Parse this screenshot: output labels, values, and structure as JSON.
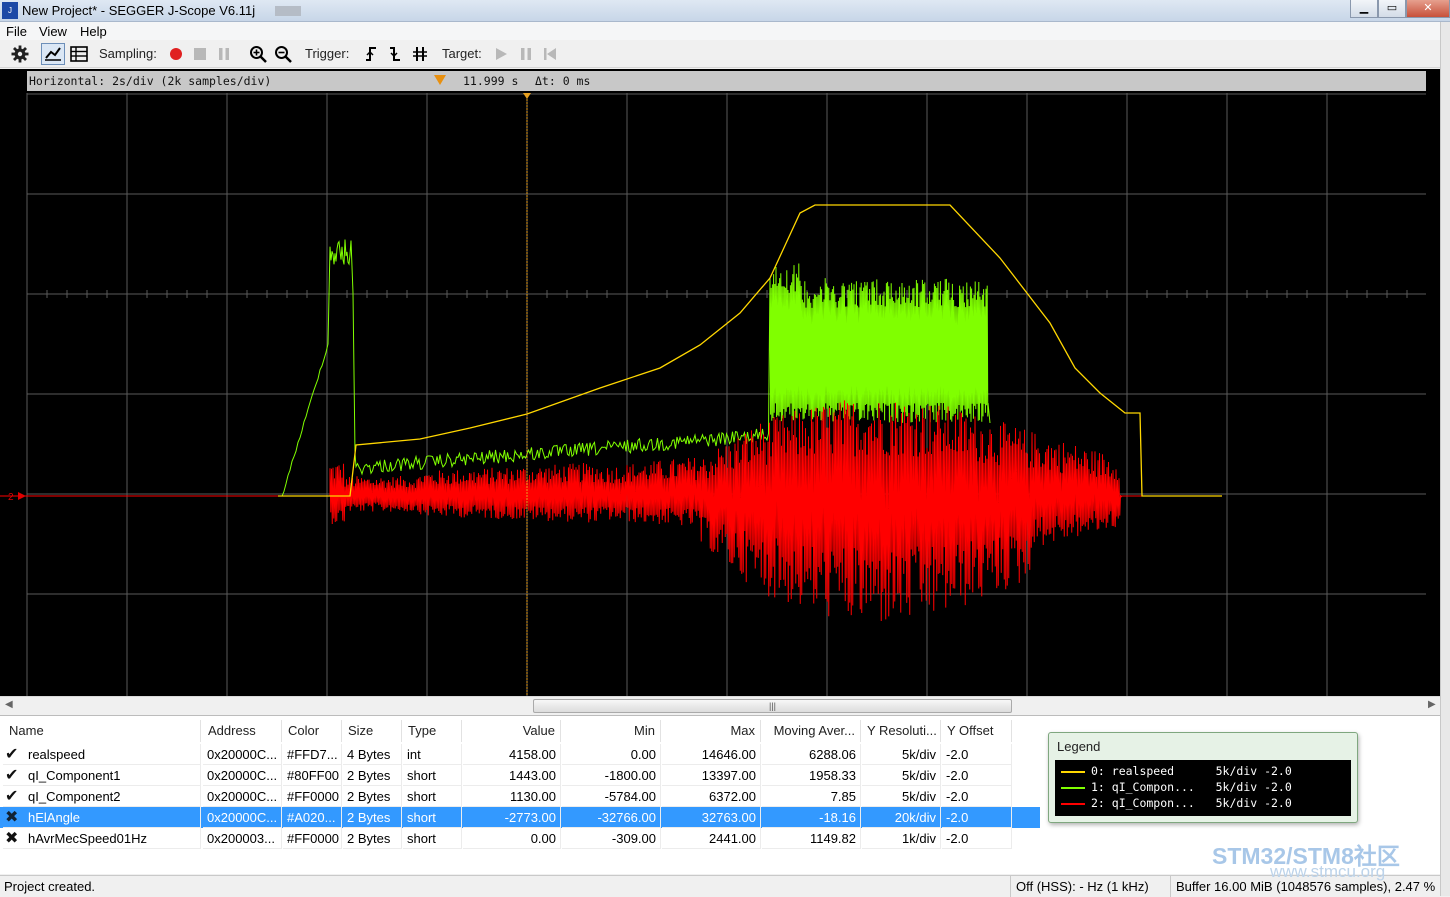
{
  "window": {
    "title": "New Project* - SEGGER J-Scope V6.11j",
    "app_icon_text": "J-Scope",
    "controls": {
      "minimize": "▁",
      "maximize": "▭",
      "close": "✕"
    }
  },
  "menu": {
    "items": [
      {
        "label": "File",
        "mnemonic": "F"
      },
      {
        "label": "View",
        "mnemonic": "V"
      },
      {
        "label": "Help",
        "mnemonic": "H"
      }
    ]
  },
  "toolbar": {
    "sampling_label": "Sampling:",
    "trigger_label": "Trigger:",
    "target_label": "Target:",
    "icons": [
      "gear-icon",
      "line-chart-icon",
      "table-icon",
      "record-icon",
      "stop-icon",
      "pause-icon",
      "zoom-in-icon",
      "zoom-out-icon",
      "trigger-rising-icon",
      "trigger-falling-icon",
      "trigger-both-icon",
      "play-icon",
      "target-pause-icon",
      "target-step-icon"
    ],
    "colors": {
      "record": "#e02020",
      "disabled": "#b8b8b8"
    }
  },
  "scope": {
    "horizontal": "Horizontal: 2s/div (2k samples/div)",
    "cursor_time": "11.999 s",
    "delta_t": "Δt: 0 ms",
    "offset_marker": "2",
    "background": "#000000",
    "grid_color": "#5a5a5a",
    "cursor_color": "#e8a020"
  },
  "table": {
    "columns": [
      "Name",
      "Address",
      "Color",
      "Size",
      "Type",
      "Value",
      "Min",
      "Max",
      "Moving Aver...",
      "Y Resoluti...",
      "Y Offset"
    ],
    "rows": [
      {
        "enabled": "✔",
        "name": "realspeed",
        "address": "0x20000C...",
        "color": "#FFD7...",
        "size": "4 Bytes",
        "type": "int",
        "value": "4158.00",
        "min": "0.00",
        "max": "14646.00",
        "avg": "6288.06",
        "yres": "5k/div",
        "yoff": "-2.0"
      },
      {
        "enabled": "✔",
        "name": "qI_Component1",
        "address": "0x20000C...",
        "color": "#80FF00",
        "size": "2 Bytes",
        "type": "short",
        "value": "1443.00",
        "min": "-1800.00",
        "max": "13397.00",
        "avg": "1958.33",
        "yres": "5k/div",
        "yoff": "-2.0"
      },
      {
        "enabled": "✔",
        "name": "qI_Component2",
        "address": "0x20000C...",
        "color": "#FF0000",
        "size": "2 Bytes",
        "type": "short",
        "value": "1130.00",
        "min": "-5784.00",
        "max": "6372.00",
        "avg": "7.85",
        "yres": "5k/div",
        "yoff": "-2.0"
      },
      {
        "enabled": "✖",
        "name": "hElAngle",
        "address": "0x20000C...",
        "color": "#A020...",
        "size": "2 Bytes",
        "type": "short",
        "value": "-2773.00",
        "min": "-32766.00",
        "max": "32763.00",
        "avg": "-18.16",
        "yres": "20k/div",
        "yoff": "-2.0"
      },
      {
        "enabled": "✖",
        "name": "hAvrMecSpeed01Hz",
        "address": "0x200003...",
        "color": "#FF0000",
        "size": "2 Bytes",
        "type": "short",
        "value": "0.00",
        "min": "-309.00",
        "max": "2441.00",
        "avg": "1149.82",
        "yres": "1k/div",
        "yoff": "-2.0"
      }
    ],
    "selected_row": 3
  },
  "legend": {
    "title": "Legend",
    "entries": [
      {
        "text": "0: realspeed      5k/div -2.0",
        "color": "#FFD700"
      },
      {
        "text": "1: qI_Compon...   5k/div -2.0",
        "color": "#80FF00"
      },
      {
        "text": "2: qI_Compon...   5k/div -2.0",
        "color": "#FF0000"
      }
    ]
  },
  "status": {
    "message": "Project created.",
    "clock": "Off (HSS): - Hz (1 kHz)",
    "buffer": "Buffer 16.00 MiB (1048576 samples), 2.47 %"
  },
  "watermark": {
    "main": "STM32/STM8社区",
    "sub": "www.stmcu.org"
  },
  "scrollbar": {
    "grip": "|||"
  }
}
